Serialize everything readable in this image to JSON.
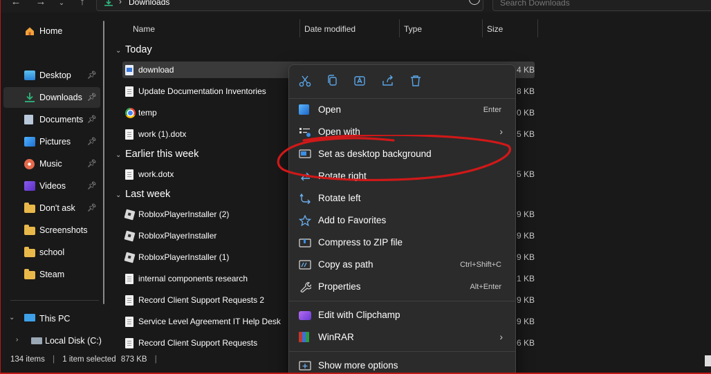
{
  "address": {
    "path": "Downloads"
  },
  "search": {
    "placeholder": "Search Downloads"
  },
  "sidebar": {
    "items": [
      {
        "label": "Home",
        "icon": "home-icon"
      },
      {
        "label": "Desktop",
        "icon": "desktop-icon",
        "pinned": true
      },
      {
        "label": "Downloads",
        "icon": "download-icon",
        "pinned": true,
        "selected": true
      },
      {
        "label": "Documents",
        "icon": "documents-icon",
        "pinned": true
      },
      {
        "label": "Pictures",
        "icon": "pictures-icon",
        "pinned": true
      },
      {
        "label": "Music",
        "icon": "music-icon",
        "pinned": true
      },
      {
        "label": "Videos",
        "icon": "videos-icon",
        "pinned": true
      },
      {
        "label": "Don't ask",
        "icon": "folder-icon",
        "pinned": true
      },
      {
        "label": "Screenshots",
        "icon": "folder-icon"
      },
      {
        "label": "school",
        "icon": "folder-icon"
      },
      {
        "label": "Steam",
        "icon": "folder-icon"
      },
      {
        "label": "This PC",
        "icon": "computer-icon"
      },
      {
        "label": "Local Disk (C:)",
        "icon": "disk-icon"
      }
    ]
  },
  "columns": {
    "name": "Name",
    "date": "Date modified",
    "type": "Type",
    "size": "Size"
  },
  "groups": {
    "today": "Today",
    "earlier": "Earlier this week",
    "last_week": "Last week"
  },
  "files": [
    {
      "name": "download",
      "size": "4 KB",
      "icon": "image-file-icon",
      "selected": true
    },
    {
      "name": "Update Documentation Inventories",
      "size": "8 KB",
      "icon": "document-file-icon"
    },
    {
      "name": "temp",
      "size": "0 KB",
      "icon": "chrome-icon"
    },
    {
      "name": "work (1).dotx",
      "size": "5 KB",
      "icon": "document-file-icon"
    },
    {
      "name": "work.dotx",
      "size": "5 KB",
      "icon": "document-file-icon"
    },
    {
      "name": "RobloxPlayerInstaller (2)",
      "size": "9 KB",
      "icon": "roblox-icon"
    },
    {
      "name": "RobloxPlayerInstaller",
      "size": "9 KB",
      "icon": "roblox-icon"
    },
    {
      "name": "RobloxPlayerInstaller (1)",
      "size": "9 KB",
      "icon": "roblox-icon"
    },
    {
      "name": "internal components research",
      "size": "1 KB",
      "icon": "document-file-icon"
    },
    {
      "name": "Record Client Support Requests 2",
      "size": "9 KB",
      "icon": "document-file-icon"
    },
    {
      "name": "Service Level Agreement IT Help Desk",
      "size": "9 KB",
      "icon": "document-file-icon"
    },
    {
      "name": "Record Client Support Requests",
      "size": "6 KB",
      "icon": "document-file-icon"
    }
  ],
  "status": {
    "items": "134 items",
    "selected": "1 item selected",
    "size": "873 KB"
  },
  "context_menu": {
    "quick_actions": [
      "cut-icon",
      "copy-icon",
      "rename-icon",
      "share-icon",
      "delete-icon"
    ],
    "items": [
      {
        "label": "Open",
        "shortcut": "Enter",
        "icon": "open-photo-icon"
      },
      {
        "label": "Open with",
        "shortcut": "",
        "icon": "open-with-icon",
        "submenu": true
      },
      {
        "label": "Set as desktop background",
        "shortcut": "",
        "icon": "desktop-background-icon"
      },
      {
        "label": "Rotate right",
        "shortcut": "",
        "icon": "rotate-right-icon"
      },
      {
        "label": "Rotate left",
        "shortcut": "",
        "icon": "rotate-left-icon"
      },
      {
        "label": "Add to Favorites",
        "shortcut": "",
        "icon": "star-icon"
      },
      {
        "label": "Compress to ZIP file",
        "shortcut": "",
        "icon": "zip-icon"
      },
      {
        "label": "Copy as path",
        "shortcut": "Ctrl+Shift+C",
        "icon": "copy-path-icon"
      },
      {
        "label": "Properties",
        "shortcut": "Alt+Enter",
        "icon": "wrench-icon"
      },
      {
        "label": "Edit with Clipchamp",
        "shortcut": "",
        "icon": "clipchamp-icon"
      },
      {
        "label": "WinRAR",
        "shortcut": "",
        "icon": "winrar-icon",
        "submenu": true
      },
      {
        "label": "Show more options",
        "shortcut": "",
        "icon": "more-options-icon"
      }
    ]
  },
  "colors": {
    "accent": "#5aa6e8",
    "annotation": "#d01818",
    "folder": "#e9b84a"
  }
}
